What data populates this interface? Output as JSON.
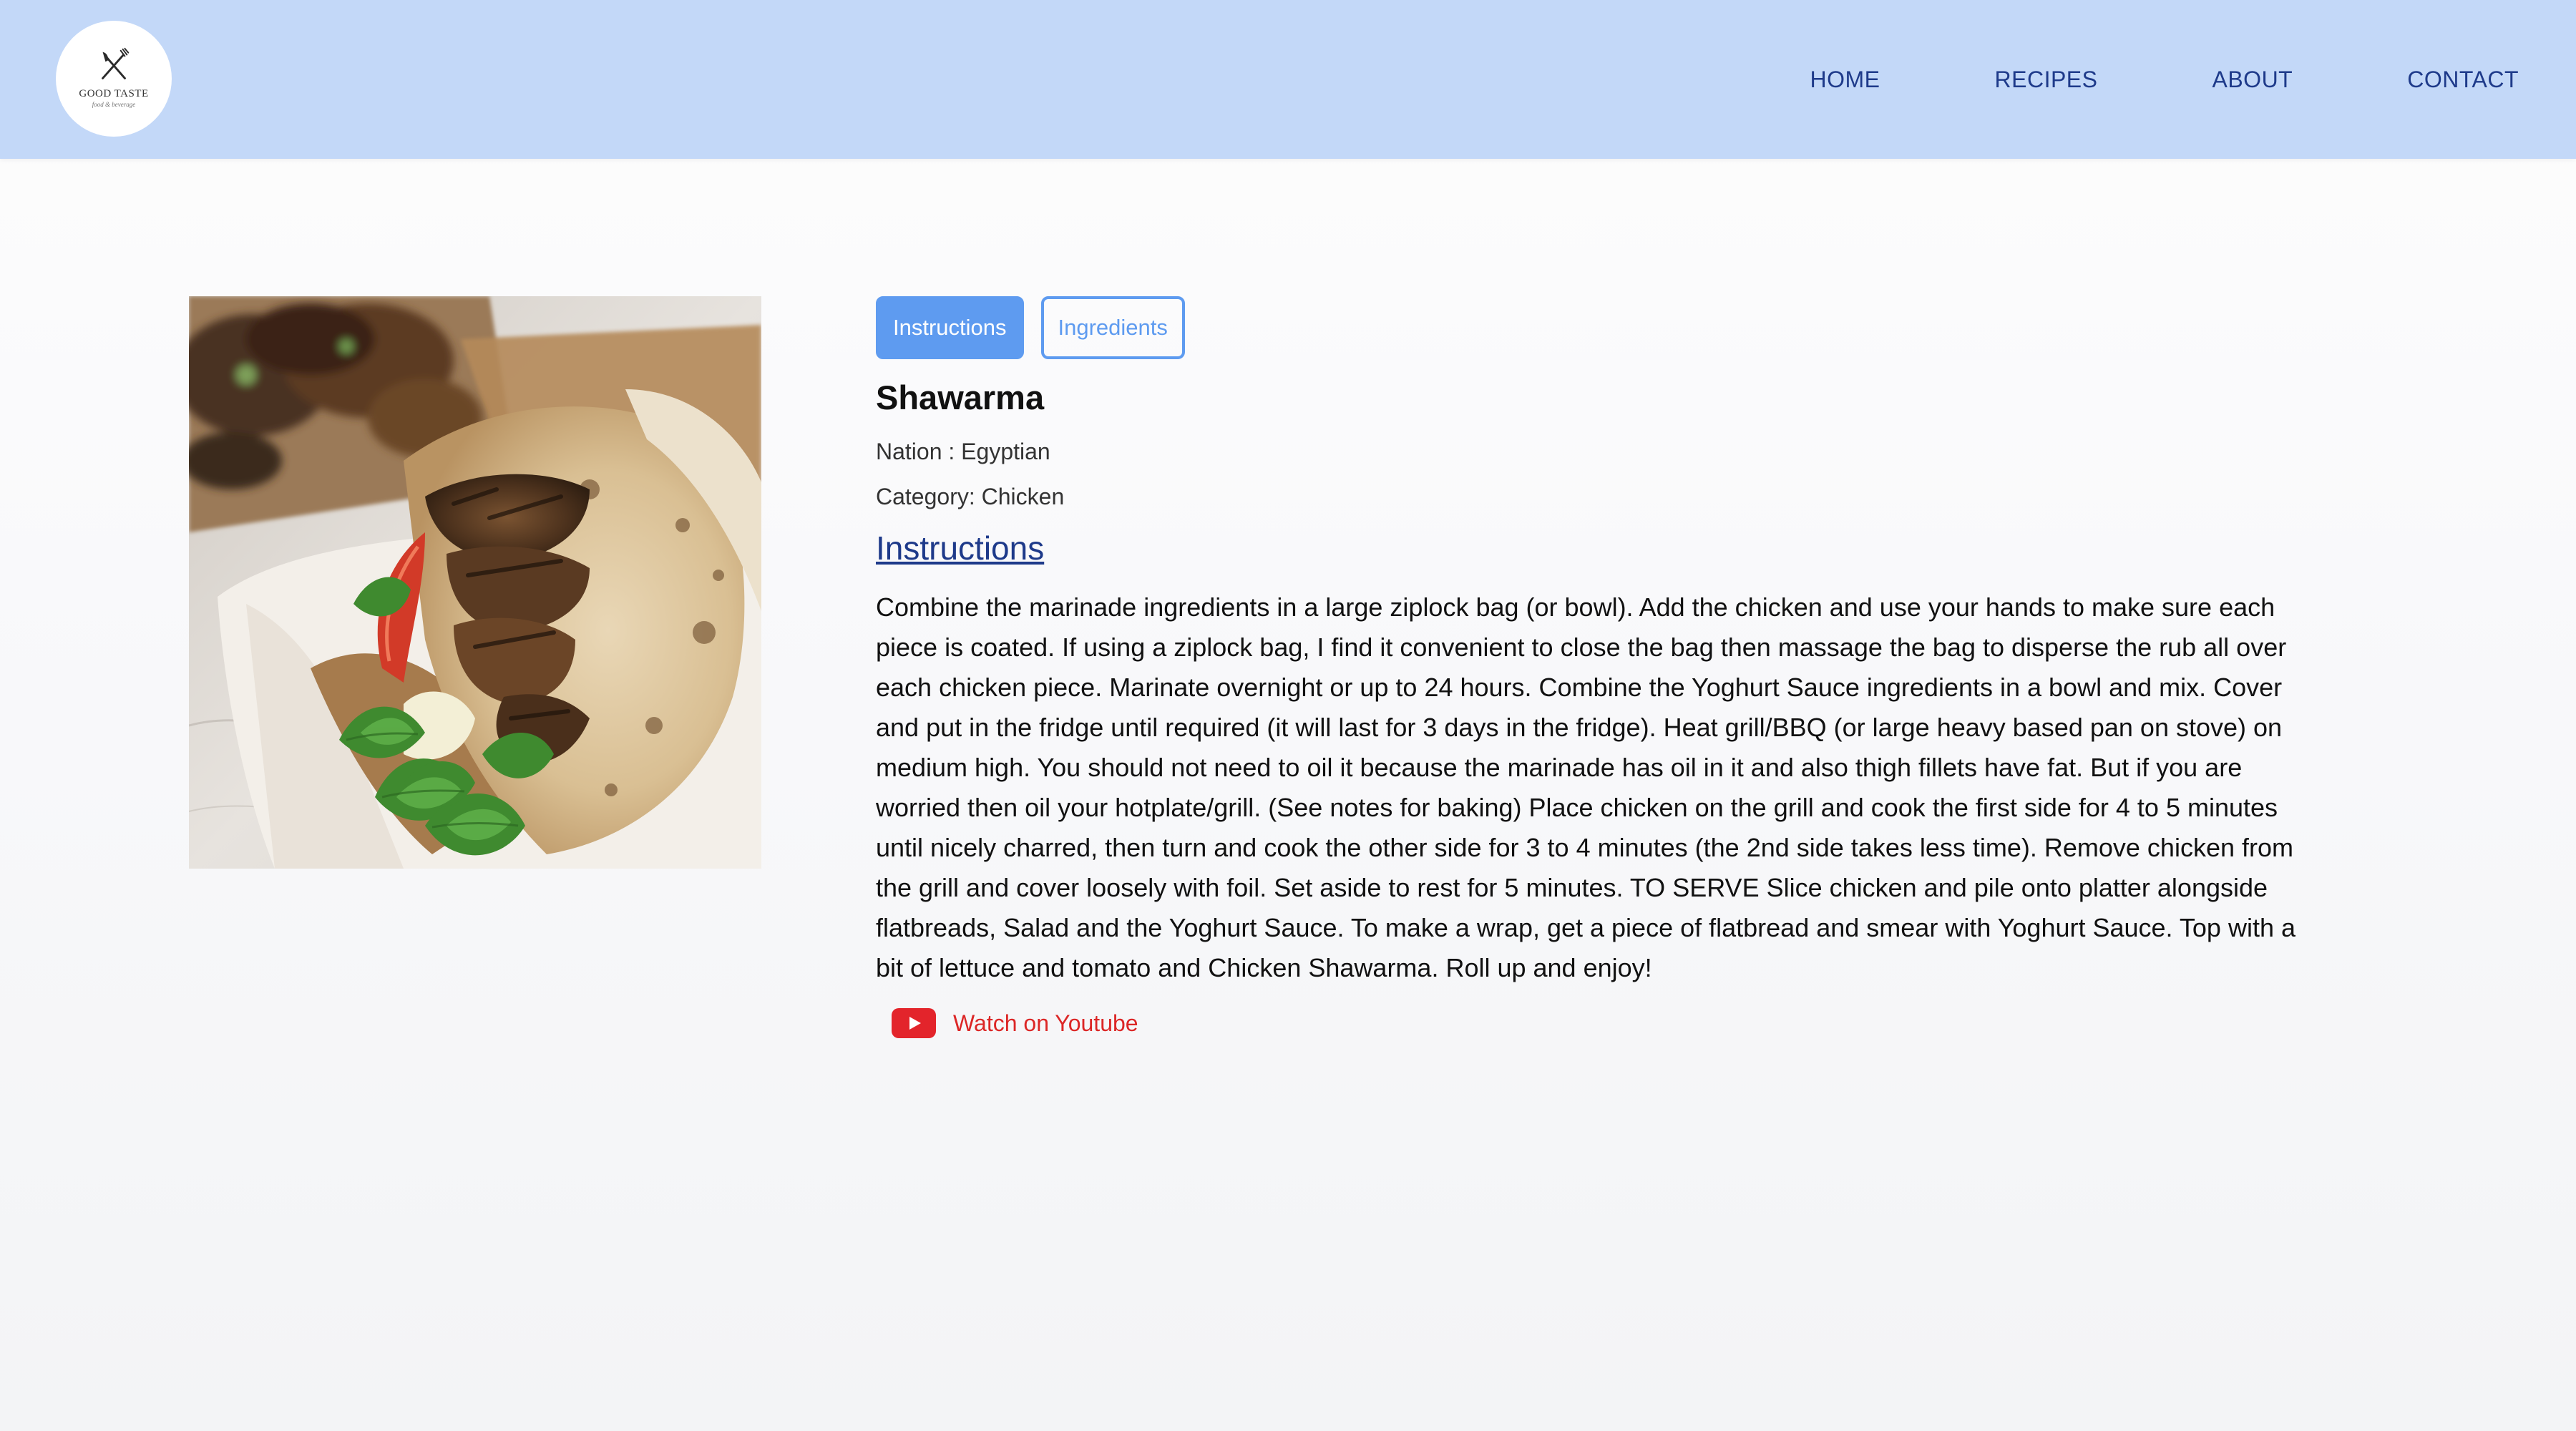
{
  "brand": {
    "name": "GOOD TASTE",
    "tagline": "food & beverage"
  },
  "nav": {
    "items": [
      {
        "label": "HOME"
      },
      {
        "label": "RECIPES"
      },
      {
        "label": "ABOUT"
      },
      {
        "label": "CONTACT"
      }
    ]
  },
  "recipe": {
    "image_alt": "Shawarma",
    "tabs": [
      {
        "label": "Instructions",
        "active": true
      },
      {
        "label": "Ingredients",
        "active": false
      }
    ],
    "title": "Shawarma",
    "nation": "Nation : Egyptian",
    "category": "Category: Chicken",
    "section_heading": "Instructions",
    "instructions": "Combine the marinade ingredients in a large ziplock bag (or bowl). Add the chicken and use your hands to make sure each piece is coated. If using a ziplock bag, I find it convenient to close the bag then massage the bag to disperse the rub all over each chicken piece. Marinate overnight or up to 24 hours. Combine the Yoghurt Sauce ingredients in a bowl and mix. Cover and put in the fridge until required (it will last for 3 days in the fridge). Heat grill/BBQ (or large heavy based pan on stove) on medium high. You should not need to oil it because the marinade has oil in it and also thigh fillets have fat. But if you are worried then oil your hotplate/grill. (See notes for baking) Place chicken on the grill and cook the first side for 4 to 5 minutes until nicely charred, then turn and cook the other side for 3 to 4 minutes (the 2nd side takes less time). Remove chicken from the grill and cover loosely with foil. Set aside to rest for 5 minutes. TO SERVE Slice chicken and pile onto platter alongside flatbreads, Salad and the Yoghurt Sauce. To make a wrap, get a piece of flatbread and smear with Yoghurt Sauce. Top with a bit of lettuce and tomato and Chicken Shawarma. Roll up and enjoy!",
    "youtube_label": "Watch on Youtube",
    "youtube_icon": "youtube-icon"
  },
  "colors": {
    "navbar_bg": "#c3d8f8",
    "nav_text": "#1e3a8a",
    "tab_accent": "#5e9bf0",
    "youtube_red": "#dc2626"
  }
}
